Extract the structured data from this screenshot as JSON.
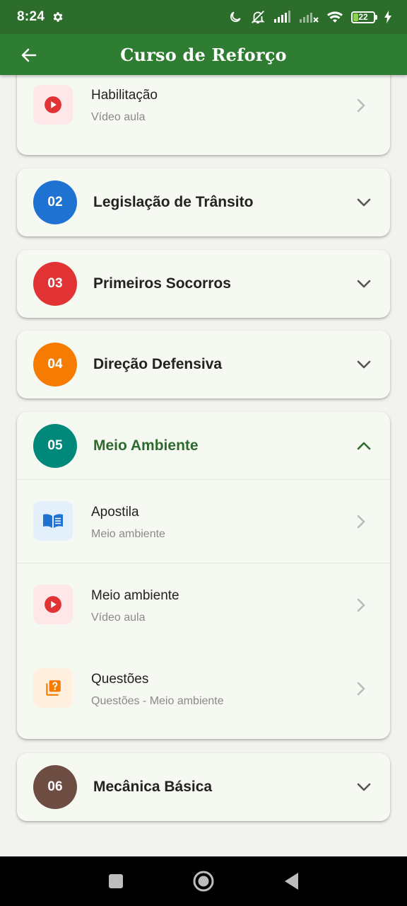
{
  "status_bar": {
    "time": "8:24",
    "battery_level": 22,
    "battery_label": "22",
    "icons": [
      "gear-icon",
      "moon-icon",
      "alarm-off-icon",
      "signal-icon",
      "signal-off-icon",
      "wifi-icon",
      "battery-icon",
      "charging-icon"
    ]
  },
  "app_bar": {
    "title": "Curso de Reforço",
    "back_icon": "arrow-left-icon"
  },
  "partial_card": {
    "lesson": {
      "title": "Habilitação",
      "subtitle": "Vídeo aula",
      "icon": "play-icon"
    }
  },
  "modules": [
    {
      "number": "02",
      "title": "Legislação de Trânsito",
      "color": "#1e73d2",
      "expanded": false
    },
    {
      "number": "03",
      "title": "Primeiros Socorros",
      "color": "#e13334",
      "expanded": false
    },
    {
      "number": "04",
      "title": "Direção Defensiva",
      "color": "#f57c00",
      "expanded": false
    },
    {
      "number": "05",
      "title": "Meio Ambiente",
      "color": "#00897b",
      "expanded": true
    },
    {
      "number": "06",
      "title": "Mecânica Básica",
      "color": "#6d4c41",
      "expanded": false
    }
  ],
  "expanded_module_lessons": [
    {
      "title": "Apostila",
      "subtitle": "Meio ambiente",
      "icon": "book-icon",
      "icon_color": "#1e73d2",
      "icon_bg": "#e3f0fc"
    },
    {
      "title": "Meio ambiente",
      "subtitle": "Vídeo aula",
      "icon": "play-icon",
      "icon_color": "#e13334",
      "icon_bg": "#fde7e9"
    },
    {
      "title": "Questões",
      "subtitle": "Questões - Meio ambiente",
      "icon": "quiz-icon",
      "icon_color": "#f57c00",
      "icon_bg": "#fff0df"
    }
  ],
  "colors": {
    "status_bar": "#2d6d2c",
    "app_bar": "#2e7d32",
    "active_title": "#2e6a2f",
    "card_bg": "#f6f8f2",
    "page_bg": "#f2f3f0"
  },
  "nav_bar": {
    "icons": [
      "recents-square-icon",
      "home-circle-icon",
      "back-triangle-icon"
    ]
  }
}
